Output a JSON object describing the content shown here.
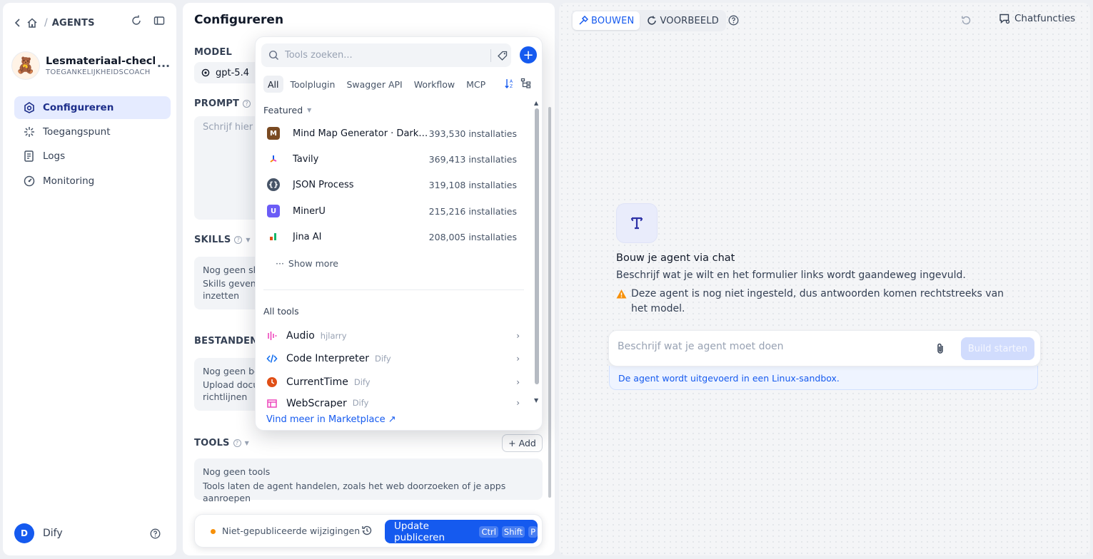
{
  "sidebar": {
    "breadcrumb_label": "AGENTS",
    "app_name": "Lesmateriaal-check",
    "app_sub": "TOEGANKELIJKHEIDSCOACH",
    "nav": [
      {
        "label": "Configureren",
        "icon": "robot-icon"
      },
      {
        "label": "Toegangspunt",
        "icon": "access-point-icon"
      },
      {
        "label": "Logs",
        "icon": "logs-icon"
      },
      {
        "label": "Monitoring",
        "icon": "gauge-icon"
      }
    ],
    "user_initial": "D",
    "user_name": "Dify"
  },
  "config": {
    "title": "Configureren",
    "model_label": "MODEL",
    "model_value": "gpt-5.4",
    "prompt_label": "PROMPT",
    "prompt_placeholder": "Schrijf hier",
    "skills_label": "SKILLS",
    "skills_l1": "Nog geen sk",
    "skills_l2": "Skills geven",
    "skills_l3": "inzetten",
    "files_label": "BESTANDEN",
    "files_l1": "Nog geen be",
    "files_l2": "Upload docu",
    "files_l3": "richtlijnen",
    "tools_label": "TOOLS",
    "add_label": "Add",
    "tools_empty_title": "Nog geen tools",
    "tools_empty_desc": "Tools laten de agent handelen, zoals het web doorzoeken of je apps aanroepen",
    "unpublished": "Niet-gepubliceerde wijzigingen ·",
    "publish_label": "Update publiceren",
    "kbd": [
      "Ctrl",
      "Shift",
      "P"
    ]
  },
  "popover": {
    "search_placeholder": "Tools zoeken...",
    "tabs": [
      "All",
      "Toolplugin",
      "Swagger API",
      "Workflow",
      "MCP"
    ],
    "featured_label": "Featured",
    "featured": [
      {
        "name": "Mind Map Generator · Dark A...",
        "count": "393,530 installaties",
        "color": "#8a5a2b"
      },
      {
        "name": "Tavily",
        "count": "369,413 installaties",
        "color": "#f79009"
      },
      {
        "name": "JSON Process",
        "count": "319,108 installaties",
        "color": "#667085"
      },
      {
        "name": "MinerU",
        "count": "215,216 installaties",
        "color": "#6b5cf6"
      },
      {
        "name": "Jina AI",
        "count": "208,005 installaties",
        "color": "#12b76a"
      }
    ],
    "show_more": "Show more",
    "all_tools_label": "All tools",
    "tools": [
      {
        "name": "Audio",
        "author": "hjlarry"
      },
      {
        "name": "Code Interpreter",
        "author": "Dify"
      },
      {
        "name": "CurrentTime",
        "author": "Dify"
      },
      {
        "name": "WebScraper",
        "author": "Dify"
      }
    ],
    "marketplace": "Vind meer in Marketplace ↗"
  },
  "right": {
    "tab_build": "BOUWEN",
    "tab_preview": "VOORBEELD",
    "chat_features": "Chatfuncties",
    "welcome_title": "Bouw je agent via chat",
    "welcome_sub": "Beschrijf wat je wilt en het formulier links wordt gaandeweg ingevuld.",
    "warning": "Deze agent is nog niet ingesteld, dus antwoorden komen rechtstreeks van het model.",
    "input_placeholder": "Beschrijf wat je agent moet doen",
    "build_button": "Build starten",
    "sandbox_note": "De agent wordt uitgevoerd in een Linux-sandbox."
  }
}
